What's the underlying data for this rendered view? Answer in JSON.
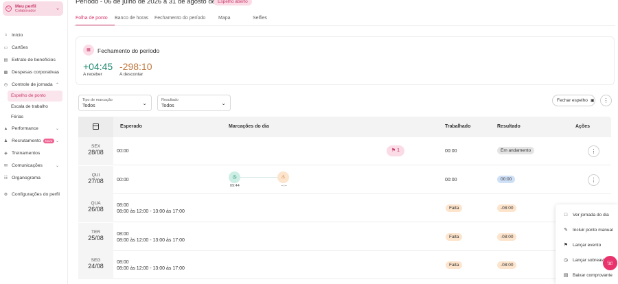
{
  "profile": {
    "name": "Meu perfil",
    "role": "Colaborador",
    "icon": "user-icon"
  },
  "nav": {
    "inicio": "Início",
    "cartoes": "Cartões",
    "extrato": "Extrato de benefícios",
    "despesas": "Despesas corporativas",
    "controle": "Controle de jornada",
    "espelho": "Espelho de ponto",
    "escala": "Escala de trabalho",
    "ferias": "Férias",
    "performance": "Performance",
    "recrutamento": "Recrutamento",
    "novo": "Novo",
    "treinamentos": "Treinamentos",
    "comunicacoes": "Comunicações",
    "organograma": "Organograma",
    "configuracoes": "Configurações do perfil"
  },
  "header": {
    "title": "Período - 06 de julho de 2026 a 31 de agosto de 2026",
    "status": "Espelho aberto"
  },
  "tabs": [
    "Folha de ponto",
    "Banco de horas",
    "Fechamento do período",
    "Mapa",
    "Selfies"
  ],
  "summary": {
    "title": "Fechamento do período",
    "receber_value": "+04:45",
    "receber_label": "A receber",
    "descontar_value": "-298:10",
    "descontar_label": "A descontar"
  },
  "filters": {
    "tipo": {
      "label": "Tipo de marcação",
      "value": "Todos"
    },
    "resultado": {
      "label": "Resultado",
      "value": "Todos"
    },
    "fechar": "Fechar espelho"
  },
  "table": {
    "headers": {
      "esperado": "Esperado",
      "marcacoes": "Marcações do dia",
      "trabalhado": "Trabalhado",
      "resultado": "Resultado",
      "acoes": "Ações"
    },
    "rows": [
      {
        "weekday": "SEX",
        "date": "28/08",
        "expected": "00:00",
        "expected_detail": "",
        "flag_count": "1",
        "worked": "00:00",
        "result": "Em andamento"
      },
      {
        "weekday": "QUI",
        "date": "27/08",
        "expected": "00:00",
        "expected_detail": "",
        "mark_in": "09:44",
        "mark_out": "--:--",
        "worked": "00:00",
        "result": "00:00"
      },
      {
        "weekday": "QUA",
        "date": "26/08",
        "expected": "08:00",
        "expected_detail": "08:00 às 12:00 - 13:00 às 17:00",
        "absence": "Falta",
        "result": "-08:00"
      },
      {
        "weekday": "TER",
        "date": "25/08",
        "expected": "08:00",
        "expected_detail": "08:00 às 12:00 - 13:00 às 17:00",
        "absence": "Falta",
        "result": "-08:00"
      },
      {
        "weekday": "SEG",
        "date": "24/08",
        "expected": "08:00",
        "expected_detail": "08:00 às 12:00 - 13:00 às 17:00",
        "absence": "Falta",
        "result": "-08:00"
      }
    ]
  },
  "menu": [
    "Ver jornada do dia",
    "Incluir ponto manual",
    "Lançar evento",
    "Lançar sobreaviso",
    "Baixar comprovante"
  ],
  "colors": {
    "accent": "#d6336c",
    "positive": "#1f8a70",
    "negative": "#c0753a"
  }
}
